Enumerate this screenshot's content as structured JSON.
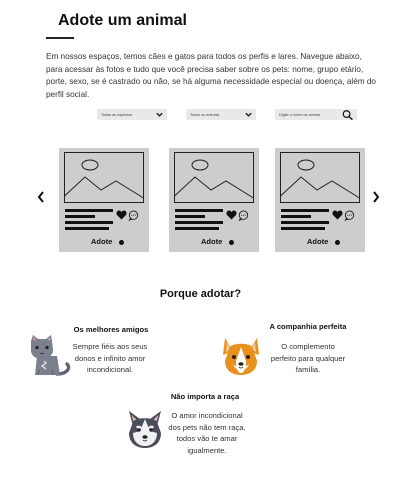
{
  "page": {
    "title": "Adote um animal",
    "intro": "Em nossos espaços, temos cães e gatos para todos os perfis e lares. Navegue abaixo, para acessar às fotos e tudo que você precisa saber sobre os pets: nome, grupo etário, porte, sexo, se é castrado ou não, se há alguma necessidade especial ou doença, além do perfil social."
  },
  "filters": {
    "species": "Todas as espécies",
    "animals": "Todos os animais",
    "search_placeholder": "Digite o nome do animal"
  },
  "carousel": {
    "cards": [
      {
        "action": "Adote"
      },
      {
        "action": "Adote"
      },
      {
        "action": "Adote"
      }
    ]
  },
  "why": {
    "title": "Porque adotar?",
    "benefits": [
      {
        "title": "Os melhores amigos",
        "text": "Sempre fiéis aos seus donos e infinito amor incondicional.",
        "icon": "cat-icon"
      },
      {
        "title": "A companhia perfeita",
        "text": "O complemento perfeito para qualquer família.",
        "icon": "corgi-dog-icon"
      },
      {
        "title": "Não importa a raça",
        "text": "O amor incondicional dos pets não tem raça, todos vão te amar igualmente.",
        "icon": "husky-dog-icon"
      }
    ]
  },
  "colors": {
    "card_bg": "#cdcdcd",
    "filter_bg": "#e9e9e9",
    "corgi": "#e8911f",
    "cat": "#7b7f8e"
  }
}
